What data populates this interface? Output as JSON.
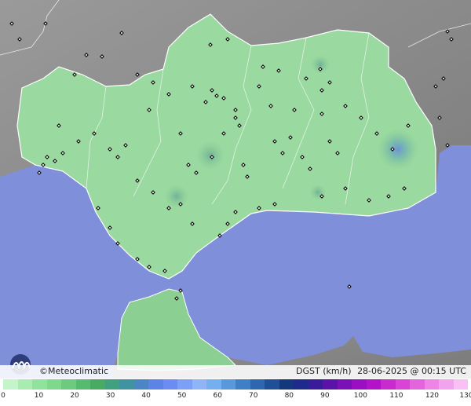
{
  "brand": {
    "name": "©Meteoclimatic"
  },
  "meta": {
    "variable": "DGST (km/h)",
    "datetime": "28-06-2025 @ 00:15 UTC"
  },
  "scale": {
    "ticks": [
      "0",
      "10",
      "20",
      "30",
      "40",
      "50",
      "60",
      "70",
      "80",
      "90",
      "100",
      "110",
      "120",
      "130"
    ],
    "colors": [
      "#c4f5c9",
      "#a8ecb0",
      "#8fe39c",
      "#7fd98d",
      "#6ccb7f",
      "#57bb6f",
      "#48aa63",
      "#40a07f",
      "#3f94a0",
      "#4a86c4",
      "#5b84e6",
      "#6b8cf2",
      "#7ca0f5",
      "#8fb5f6",
      "#74b0f0",
      "#5a98dc",
      "#3f7fc6",
      "#2d67b0",
      "#1f4f96",
      "#14387c",
      "#1e2a8c",
      "#3a1c9a",
      "#5a12a8",
      "#7a10b6",
      "#9a0fc2",
      "#b313c8",
      "#c82ace",
      "#d845d6",
      "#e464de",
      "#ed84e6",
      "#f3a2ee",
      "#f8c0f4"
    ]
  },
  "map": {
    "colors": {
      "sea": "#7f8fd9",
      "land_outside": "#8a8a8a",
      "region": "#9ad9a0",
      "border": "#ffffff"
    }
  }
}
